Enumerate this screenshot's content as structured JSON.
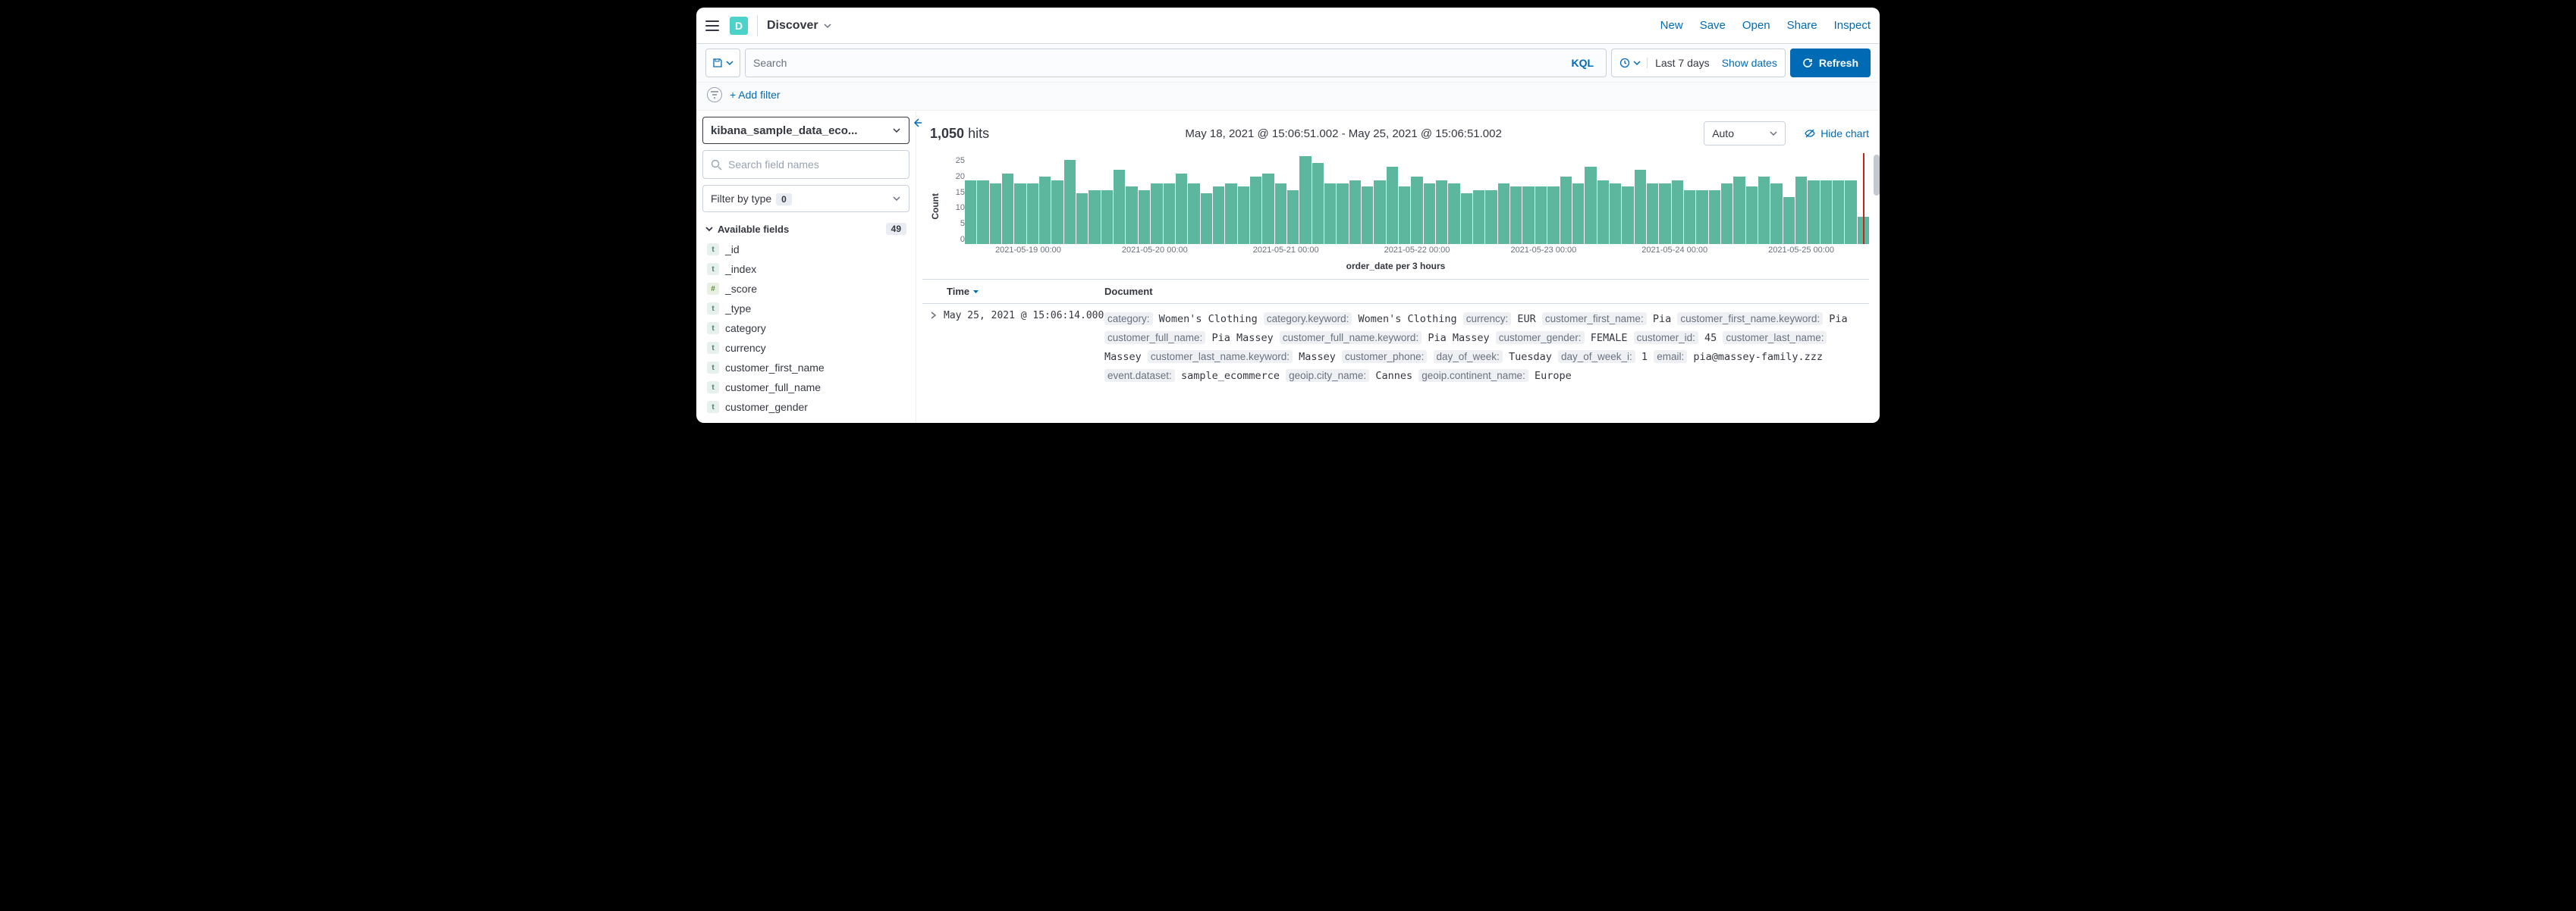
{
  "header": {
    "logo_letter": "D",
    "breadcrumb": "Discover",
    "links": [
      "New",
      "Save",
      "Open",
      "Share",
      "Inspect"
    ]
  },
  "query": {
    "search_placeholder": "Search",
    "kql_label": "KQL",
    "time_label": "Last 7 days",
    "show_dates": "Show dates",
    "refresh": "Refresh"
  },
  "filters": {
    "add_filter": "+ Add filter"
  },
  "sidebar": {
    "index_pattern": "kibana_sample_data_eco...",
    "field_search_placeholder": "Search field names",
    "filter_by_type": "Filter by type",
    "filter_count": "0",
    "available_label": "Available fields",
    "available_count": "49",
    "fields": [
      {
        "type": "t",
        "name": "_id"
      },
      {
        "type": "t",
        "name": "_index"
      },
      {
        "type": "n",
        "name": "_score"
      },
      {
        "type": "t",
        "name": "_type"
      },
      {
        "type": "t",
        "name": "category"
      },
      {
        "type": "t",
        "name": "currency"
      },
      {
        "type": "t",
        "name": "customer_first_name"
      },
      {
        "type": "t",
        "name": "customer_full_name"
      },
      {
        "type": "t",
        "name": "customer_gender"
      }
    ]
  },
  "results": {
    "hit_count": "1,050",
    "hits_word": "hits",
    "time_range": "May 18, 2021 @ 15:06:51.002 - May 25, 2021 @ 15:06:51.002",
    "interval": "Auto",
    "hide_chart": "Hide chart",
    "xlabel": "order_date per 3 hours",
    "ylabel": "Count",
    "columns": {
      "time": "Time",
      "document": "Document"
    }
  },
  "chart_data": {
    "type": "bar",
    "ylabel": "Count",
    "xlabel": "order_date per 3 hours",
    "ylim": [
      0,
      27
    ],
    "yticks": [
      0,
      5,
      10,
      15,
      20,
      25
    ],
    "xticks": [
      {
        "pos": 7,
        "label": "2021-05-19 00:00"
      },
      {
        "pos": 21,
        "label": "2021-05-20 00:00"
      },
      {
        "pos": 35.5,
        "label": "2021-05-21 00:00"
      },
      {
        "pos": 50,
        "label": "2021-05-22 00:00"
      },
      {
        "pos": 64,
        "label": "2021-05-23 00:00"
      },
      {
        "pos": 78.5,
        "label": "2021-05-24 00:00"
      },
      {
        "pos": 92.5,
        "label": "2021-05-25 00:00"
      }
    ],
    "values": [
      19,
      19,
      18,
      21,
      18,
      18,
      20,
      19,
      25,
      15,
      16,
      16,
      22,
      17,
      16,
      18,
      18,
      21,
      18,
      15,
      17,
      18,
      17,
      20,
      21,
      18,
      16,
      26,
      24,
      18,
      18,
      19,
      17,
      19,
      23,
      17,
      20,
      18,
      19,
      18,
      15,
      16,
      16,
      18,
      17,
      17,
      17,
      17,
      20,
      18,
      23,
      19,
      18,
      17,
      22,
      18,
      18,
      19,
      16,
      16,
      16,
      18,
      20,
      17,
      20,
      18,
      14,
      20,
      19,
      19,
      19,
      19,
      8
    ]
  },
  "row": {
    "time": "May 25, 2021 @ 15:06:14.000",
    "fields": [
      {
        "k": "category:",
        "v": "Women's Clothing"
      },
      {
        "k": "category.keyword:",
        "v": "Women's Clothing"
      },
      {
        "k": "currency:",
        "v": "EUR"
      },
      {
        "k": "customer_first_name:",
        "v": "Pia"
      },
      {
        "k": "customer_first_name.keyword:",
        "v": "Pia"
      },
      {
        "k": "customer_full_name:",
        "v": "Pia Massey"
      },
      {
        "k": "customer_full_name.keyword:",
        "v": "Pia Massey"
      },
      {
        "k": "customer_gender:",
        "v": "FEMALE"
      },
      {
        "k": "customer_id:",
        "v": "45"
      },
      {
        "k": "customer_last_name:",
        "v": "Massey"
      },
      {
        "k": "customer_last_name.keyword:",
        "v": "Massey"
      },
      {
        "k": "customer_phone:",
        "v": ""
      },
      {
        "k": "day_of_week:",
        "v": "Tuesday"
      },
      {
        "k": "day_of_week_i:",
        "v": "1"
      },
      {
        "k": "email:",
        "v": "pia@massey-family.zzz"
      },
      {
        "k": "event.dataset:",
        "v": "sample_ecommerce"
      },
      {
        "k": "geoip.city_name:",
        "v": "Cannes"
      },
      {
        "k": "geoip.continent_name:",
        "v": "Europe"
      }
    ]
  }
}
